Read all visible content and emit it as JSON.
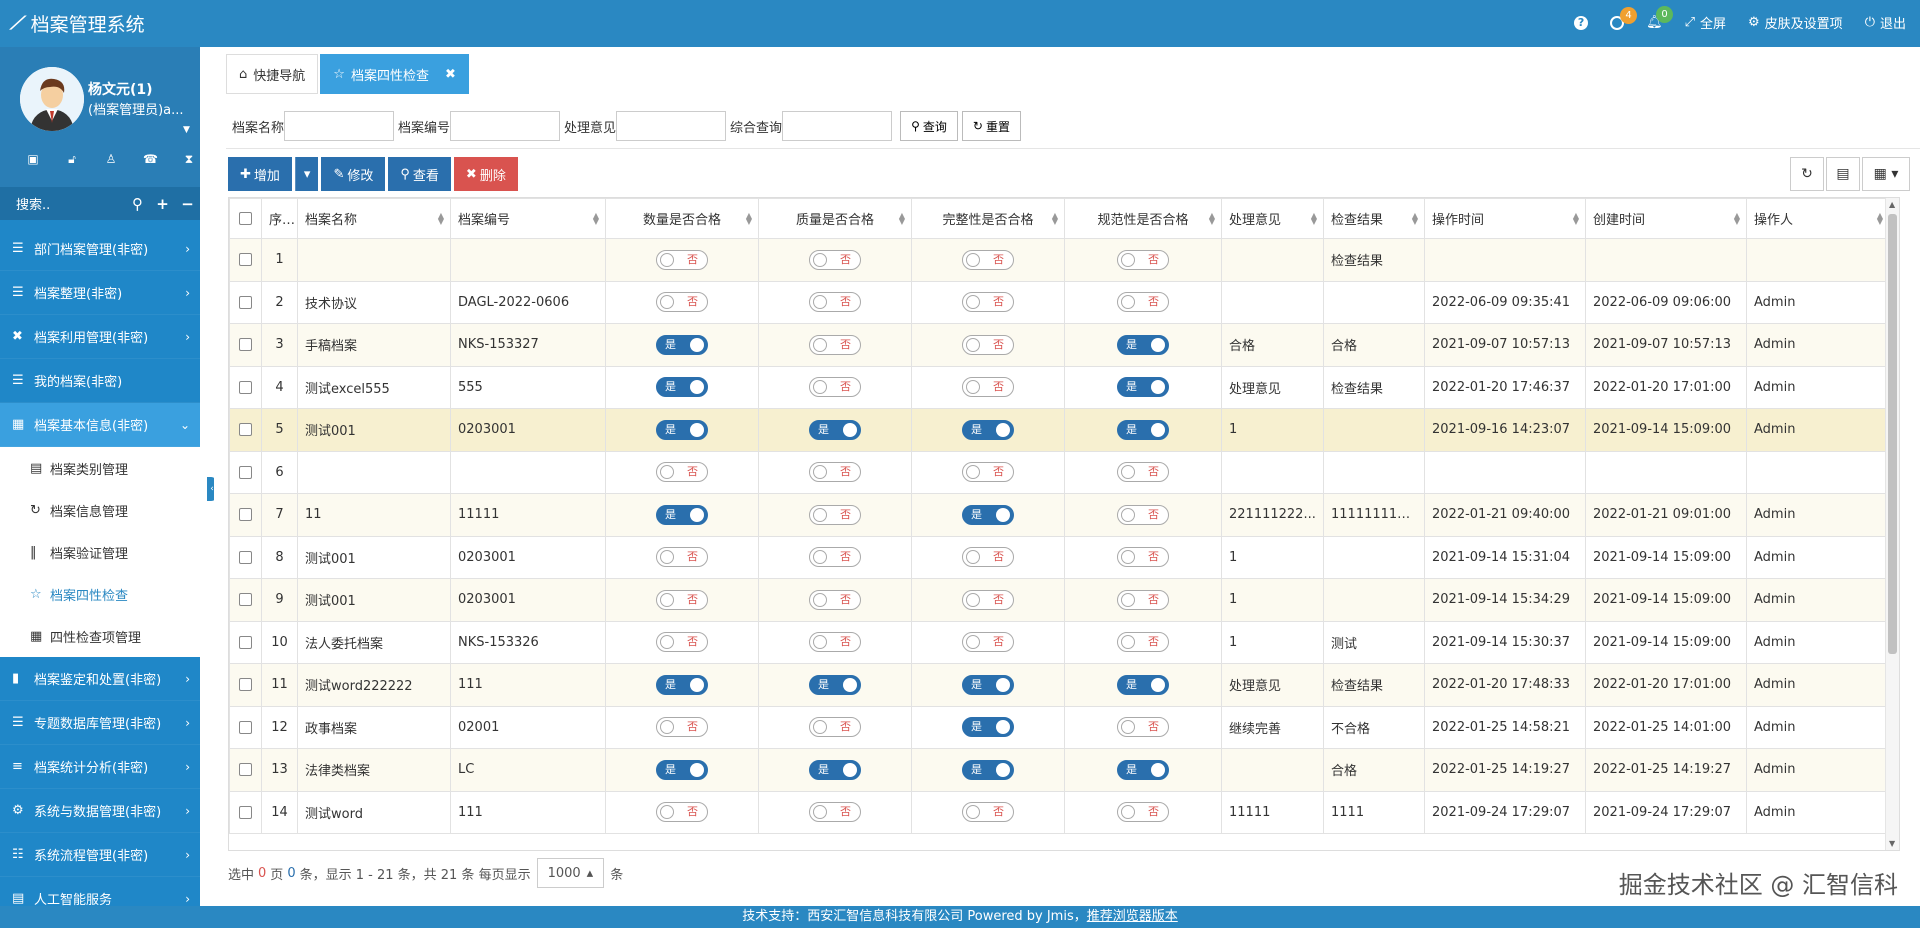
{
  "app": {
    "title": "档案管理系统"
  },
  "topbar": {
    "help_icon": "?",
    "clock_badge": "4",
    "bell_badge": "0",
    "fullscreen": "全屏",
    "skin": "皮肤及设置项",
    "logout": "退出"
  },
  "user": {
    "name": "杨文元(1)",
    "role": "(档案管理员)a..."
  },
  "search": {
    "placeholder": "搜索.."
  },
  "menu": [
    {
      "label": "部门档案管理(非密)"
    },
    {
      "label": "档案整理(非密)"
    },
    {
      "label": "档案利用管理(非密)"
    },
    {
      "label": "我的档案(非密)"
    },
    {
      "label": "档案基本信息(非密)"
    },
    {
      "label": "档案鉴定和处置(非密)"
    },
    {
      "label": "专题数据库管理(非密)"
    },
    {
      "label": "档案统计分析(非密)"
    },
    {
      "label": "系统与数据管理(非密)"
    },
    {
      "label": "系统流程管理(非密)"
    },
    {
      "label": "人工智能服务"
    }
  ],
  "submenu": [
    {
      "label": "档案类别管理"
    },
    {
      "label": "档案信息管理"
    },
    {
      "label": "档案验证管理"
    },
    {
      "label": "档案四性检查"
    },
    {
      "label": "四性检查项管理"
    }
  ],
  "tabs": [
    {
      "label": "快捷导航"
    },
    {
      "label": "档案四性检查"
    }
  ],
  "filter": {
    "name_label": "档案名称",
    "number_label": "档案编号",
    "opinion_label": "处理意见",
    "query_label": "综合查询",
    "search_btn": "查询",
    "reset_btn": "重置"
  },
  "toolbar": {
    "add": "增加",
    "edit": "修改",
    "view": "查看",
    "delete": "删除"
  },
  "table": {
    "headers": [
      "序号",
      "档案名称",
      "档案编号",
      "数量是否合格",
      "质量是否合格",
      "完整性是否合格",
      "规范性是否合格",
      "处理意见",
      "检查结果",
      "操作时间",
      "创建时间",
      "操作人"
    ],
    "on_label": "是",
    "off_label": "否",
    "rows": [
      {
        "no": "1",
        "name": "",
        "code": "",
        "q1": false,
        "q2": false,
        "q3": false,
        "q4": false,
        "opinion": "",
        "result": "检查结果",
        "optime": "",
        "ctime": "",
        "user": ""
      },
      {
        "no": "2",
        "name": "技术协议",
        "code": "DAGL-2022-0606",
        "q1": false,
        "q2": false,
        "q3": false,
        "q4": false,
        "opinion": "",
        "result": "",
        "optime": "2022-06-09 09:35:41",
        "ctime": "2022-06-09 09:06:00",
        "user": "Admin"
      },
      {
        "no": "3",
        "name": "手稿档案",
        "code": "NKS-153327",
        "q1": true,
        "q2": false,
        "q3": false,
        "q4": true,
        "opinion": "合格",
        "result": "合格",
        "optime": "2021-09-07 10:57:13",
        "ctime": "2021-09-07 10:57:13",
        "user": "Admin"
      },
      {
        "no": "4",
        "name": "测试excel555",
        "code": "555",
        "q1": true,
        "q2": false,
        "q3": false,
        "q4": true,
        "opinion": "处理意见",
        "result": "检查结果",
        "optime": "2022-01-20 17:46:37",
        "ctime": "2022-01-20 17:01:00",
        "user": "Admin"
      },
      {
        "no": "5",
        "name": "测试001",
        "code": "0203001",
        "q1": true,
        "q2": true,
        "q3": true,
        "q4": true,
        "opinion": "1",
        "result": "",
        "optime": "2021-09-16 14:23:07",
        "ctime": "2021-09-14 15:09:00",
        "user": "Admin"
      },
      {
        "no": "6",
        "name": "",
        "code": "",
        "q1": false,
        "q2": false,
        "q3": false,
        "q4": false,
        "opinion": "",
        "result": "",
        "optime": "",
        "ctime": "",
        "user": ""
      },
      {
        "no": "7",
        "name": "11",
        "code": "11111",
        "q1": true,
        "q2": false,
        "q3": true,
        "q4": false,
        "opinion": "221111222...",
        "result": "1111111111...",
        "optime": "2022-01-21 09:40:00",
        "ctime": "2022-01-21 09:01:00",
        "user": "Admin"
      },
      {
        "no": "8",
        "name": "测试001",
        "code": "0203001",
        "q1": false,
        "q2": false,
        "q3": false,
        "q4": false,
        "opinion": "1",
        "result": "",
        "optime": "2021-09-14 15:31:04",
        "ctime": "2021-09-14 15:09:00",
        "user": "Admin"
      },
      {
        "no": "9",
        "name": "测试001",
        "code": "0203001",
        "q1": false,
        "q2": false,
        "q3": false,
        "q4": false,
        "opinion": "1",
        "result": "",
        "optime": "2021-09-14 15:34:29",
        "ctime": "2021-09-14 15:09:00",
        "user": "Admin"
      },
      {
        "no": "10",
        "name": "法人委托档案",
        "code": "NKS-153326",
        "q1": false,
        "q2": false,
        "q3": false,
        "q4": false,
        "opinion": "1",
        "result": "测试",
        "optime": "2021-09-14 15:30:37",
        "ctime": "2021-09-14 15:09:00",
        "user": "Admin"
      },
      {
        "no": "11",
        "name": "测试word222222",
        "code": "111",
        "q1": true,
        "q2": true,
        "q3": true,
        "q4": true,
        "opinion": "处理意见",
        "result": "检查结果",
        "optime": "2022-01-20 17:48:33",
        "ctime": "2022-01-20 17:01:00",
        "user": "Admin"
      },
      {
        "no": "12",
        "name": "政事档案",
        "code": "02001",
        "q1": false,
        "q2": false,
        "q3": true,
        "q4": false,
        "opinion": "继续完善",
        "result": "不合格",
        "optime": "2022-01-25 14:58:21",
        "ctime": "2022-01-25 14:01:00",
        "user": "Admin"
      },
      {
        "no": "13",
        "name": "法律类档案",
        "code": "LC",
        "q1": true,
        "q2": true,
        "q3": true,
        "q4": true,
        "opinion": "",
        "result": "合格",
        "optime": "2022-01-25 14:19:27",
        "ctime": "2022-01-25 14:19:27",
        "user": "Admin"
      },
      {
        "no": "14",
        "name": "测试word",
        "code": "111",
        "q1": false,
        "q2": false,
        "q3": false,
        "q4": false,
        "opinion": "11111",
        "result": "1111",
        "optime": "2021-09-24 17:29:07",
        "ctime": "2021-09-24 17:29:07",
        "user": "Admin"
      }
    ]
  },
  "pager": {
    "p1": "选中",
    "sel": "0",
    "p2": "页",
    "page": "0",
    "p3": "条，显示 1 - 21 条，共 21 条 每页显示",
    "size": "1000",
    "p4": "条"
  },
  "watermark": "掘金技术社区 @ 汇智信科",
  "footer": {
    "text": "技术支持：西安汇智信息科技有限公司 Powered by Jmis，",
    "link": "推荐浏览器版本"
  }
}
